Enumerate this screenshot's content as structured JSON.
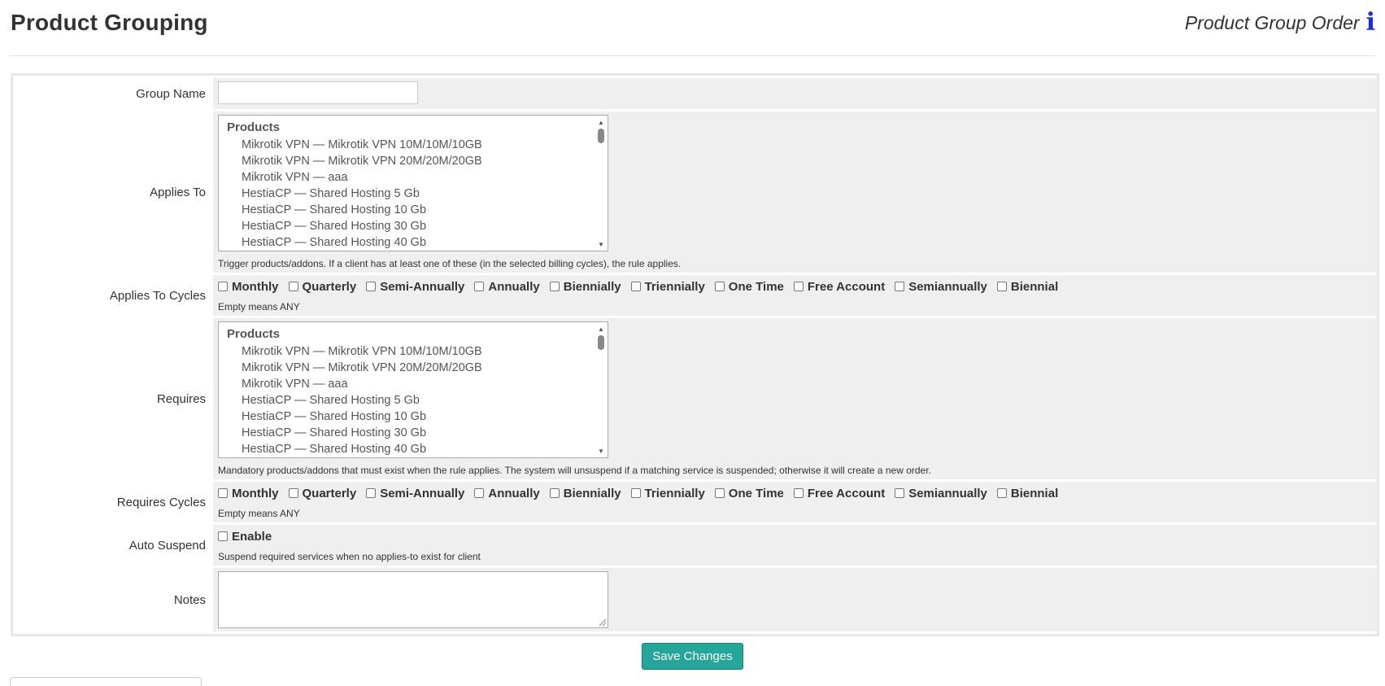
{
  "header": {
    "title": "Product Grouping",
    "order_link": "Product Group Order",
    "info_icon": "info-icon"
  },
  "form": {
    "group_name": {
      "label": "Group Name",
      "value": ""
    },
    "applies_to": {
      "label": "Applies To",
      "group": "Products",
      "options": [
        "Mikrotik VPN — Mikrotik VPN 10M/10M/10GB",
        "Mikrotik VPN — Mikrotik VPN 20M/20M/20GB",
        "Mikrotik VPN — aaa",
        "HestiaCP — Shared Hosting 5 Gb",
        "HestiaCP — Shared Hosting 10 Gb",
        "HestiaCP — Shared Hosting 30 Gb",
        "HestiaCP — Shared Hosting 40 Gb"
      ],
      "help": "Trigger products/addons. If a client has at least one of these (in the selected billing cycles), the rule applies."
    },
    "applies_to_cycles": {
      "label": "Applies To Cycles",
      "cycles": [
        "Monthly",
        "Quarterly",
        "Semi-Annually",
        "Annually",
        "Biennially",
        "Triennially",
        "One Time",
        "Free Account",
        "Semiannually",
        "Biennial"
      ],
      "help": "Empty means ANY"
    },
    "requires": {
      "label": "Requires",
      "group": "Products",
      "options": [
        "Mikrotik VPN — Mikrotik VPN 10M/10M/10GB",
        "Mikrotik VPN — Mikrotik VPN 20M/20M/20GB",
        "Mikrotik VPN — aaa",
        "HestiaCP — Shared Hosting 5 Gb",
        "HestiaCP — Shared Hosting 10 Gb",
        "HestiaCP — Shared Hosting 30 Gb",
        "HestiaCP — Shared Hosting 40 Gb"
      ],
      "help": "Mandatory products/addons that must exist when the rule applies. The system will unsuspend if a matching service is suspended; otherwise it will create a new order."
    },
    "requires_cycles": {
      "label": "Requires Cycles",
      "cycles": [
        "Monthly",
        "Quarterly",
        "Semi-Annually",
        "Annually",
        "Biennially",
        "Triennially",
        "One Time",
        "Free Account",
        "Semiannually",
        "Biennial"
      ],
      "help": "Empty means ANY"
    },
    "auto_suspend": {
      "label": "Auto Suspend",
      "option": "Enable",
      "help": "Suspend required services when no applies-to exist for client"
    },
    "notes": {
      "label": "Notes",
      "value": ""
    }
  },
  "actions": {
    "save": "Save Changes"
  },
  "colors": {
    "accent": "#26a69a",
    "info": "#1f2fd6",
    "field_bg": "#efefef"
  }
}
